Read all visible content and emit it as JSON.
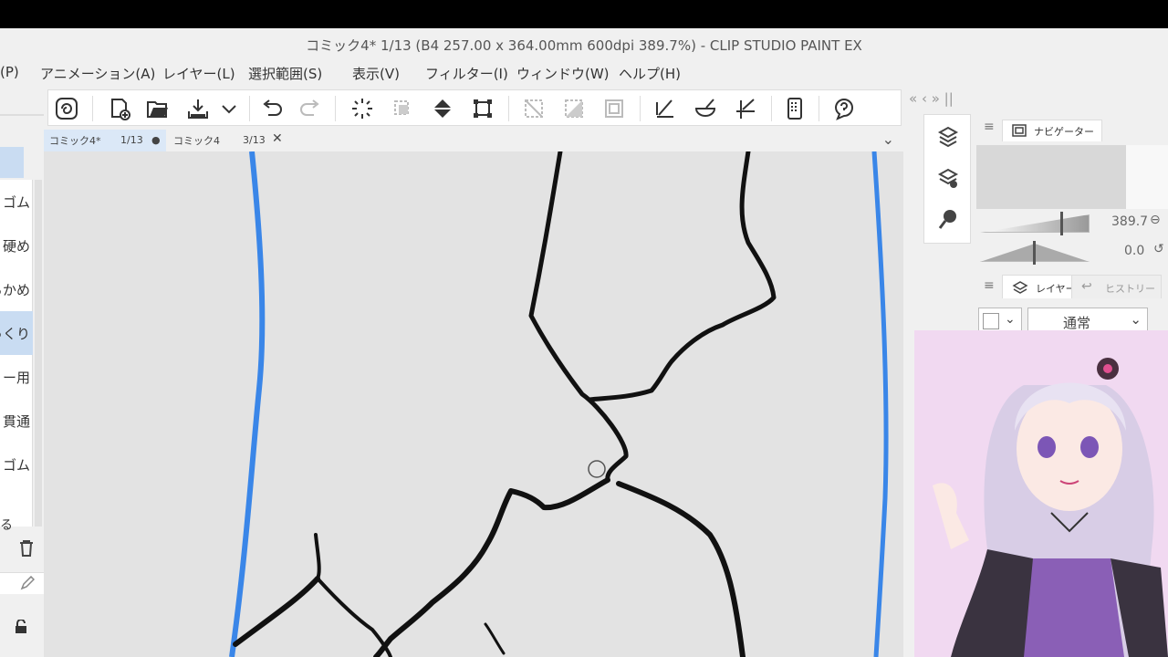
{
  "app": {
    "window_title": "コミック4* 1/13 (B4 257.00 x 364.00mm 600dpi 389.7%)  - CLIP STUDIO PAINT EX"
  },
  "menu": {
    "items": [
      "(P)",
      "アニメーション(A)",
      "レイヤー(L)",
      "選択範囲(S)",
      "表示(V)",
      "フィルター(I)",
      "ウィンドウ(W)",
      "ヘルプ(H)"
    ]
  },
  "command_bar": {
    "buttons": [
      "clip-studio-icon",
      "new-file-icon",
      "open-file-icon",
      "export-icon",
      "dropdown-icon",
      "undo-icon",
      "redo-icon",
      "loading-icon",
      "select-icon",
      "fill-icon",
      "transform-icon",
      "clear-selection-icon",
      "invert-selection-icon",
      "border-icon",
      "pen-ruler-icon",
      "bowl-icon",
      "ruler-icon",
      "device-icon",
      "help-icon"
    ]
  },
  "tabs": [
    {
      "name": "コミック4*",
      "page": "1/13",
      "marker": "●"
    },
    {
      "name": "コミック4",
      "page": "3/13",
      "marker": "✕"
    }
  ],
  "tool_list": {
    "items": [
      "ゴム",
      "硬め",
      "らかめ",
      "ざっくり",
      "ー用",
      "貫通",
      "ゴム"
    ],
    "selected_index": 3,
    "footer": "る"
  },
  "navigator": {
    "tab_label": "ナビゲーター",
    "zoom_value": "389.7",
    "rotation_value": "0.0"
  },
  "layers": {
    "tabs": [
      "レイヤー",
      "ヒストリー"
    ],
    "blend_mode": "通常"
  },
  "dock_header": "« ‹  »  ||",
  "colors": {
    "ruler_blue": "#3a86e8",
    "selection": "#c9dcf2",
    "background": "#f0f0f0"
  }
}
